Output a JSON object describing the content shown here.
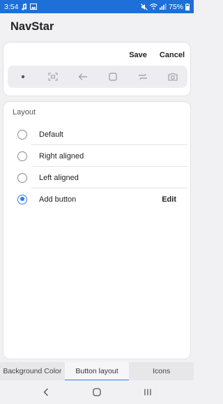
{
  "status_bar": {
    "time": "3:54",
    "battery": "75%"
  },
  "app_bar": {
    "title": "NavStar"
  },
  "top_card": {
    "save_label": "Save",
    "cancel_label": "Cancel",
    "icons": [
      "dot-icon",
      "scan-icon",
      "back-arrow-icon",
      "square-icon",
      "swap-icon",
      "camera-icon"
    ]
  },
  "layout_card": {
    "section_label": "Layout",
    "options": [
      {
        "label": "Default",
        "selected": false
      },
      {
        "label": "Right aligned",
        "selected": false
      },
      {
        "label": "Left aligned",
        "selected": false
      },
      {
        "label": "Add button",
        "selected": true
      }
    ],
    "edit_label": "Edit"
  },
  "tabs": [
    "Background Color",
    "Button layout",
    "Icons"
  ],
  "active_tab": "Button layout",
  "accent_color": "#2f7de8",
  "statusbar_color": "#1e6fd8"
}
